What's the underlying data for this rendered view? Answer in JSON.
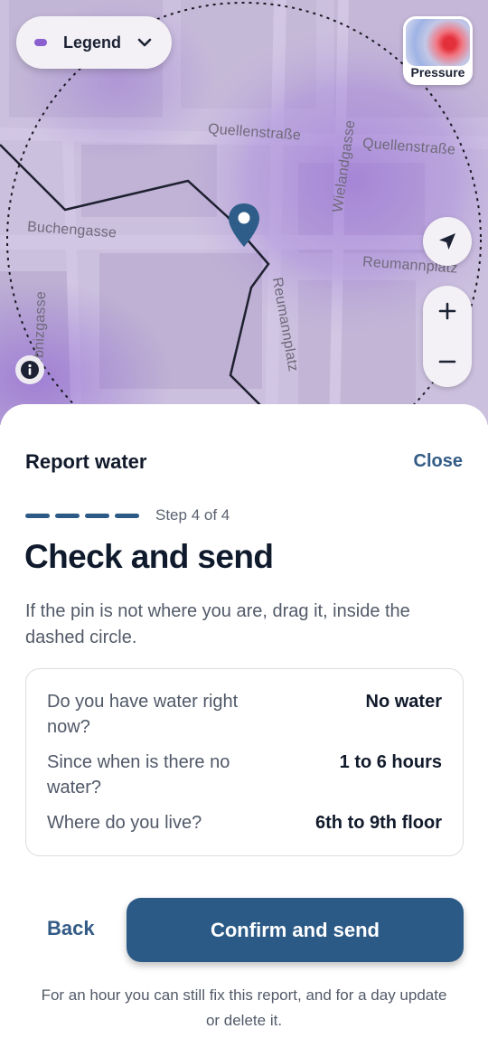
{
  "map": {
    "streets": {
      "quellenstrasse_1": "Quellenstraße",
      "quellenstrasse_2": "Quellenstraße",
      "buchengasse": "Buchengasse",
      "wielandgasse": "Wielandgasse",
      "reumannplatz_1": "Reumannplatz",
      "reumannplatz_2": "Reumannplatz",
      "leibnizgasse": "bnizgasse"
    },
    "legend": {
      "label": "Legend",
      "icon": "chevron-down-icon",
      "dot_color": "#8a5fd0"
    },
    "pressure": {
      "label": "Pressure"
    },
    "heat_color": "#8e5fd6",
    "pin_color": "#2f5d89"
  },
  "sheet": {
    "title": "Report water",
    "close_label": "Close",
    "step_label": "Step 4 of 4",
    "heading": "Check and send",
    "helper": "If the pin is not where you are, drag it, inside the dashed circle.",
    "summary": [
      {
        "question": "Do you have water right now?",
        "answer": "No water"
      },
      {
        "question": "Since when is there no water?",
        "answer": "1 to 6 hours"
      },
      {
        "question": "Where do you live?",
        "answer": "6th to 9th floor"
      }
    ],
    "back_label": "Back",
    "confirm_label": "Confirm and send",
    "footnote": "For an hour you can still fix this report, and for a day update or delete it."
  },
  "colors": {
    "accent": "#2c5a87",
    "link": "#335b86"
  }
}
